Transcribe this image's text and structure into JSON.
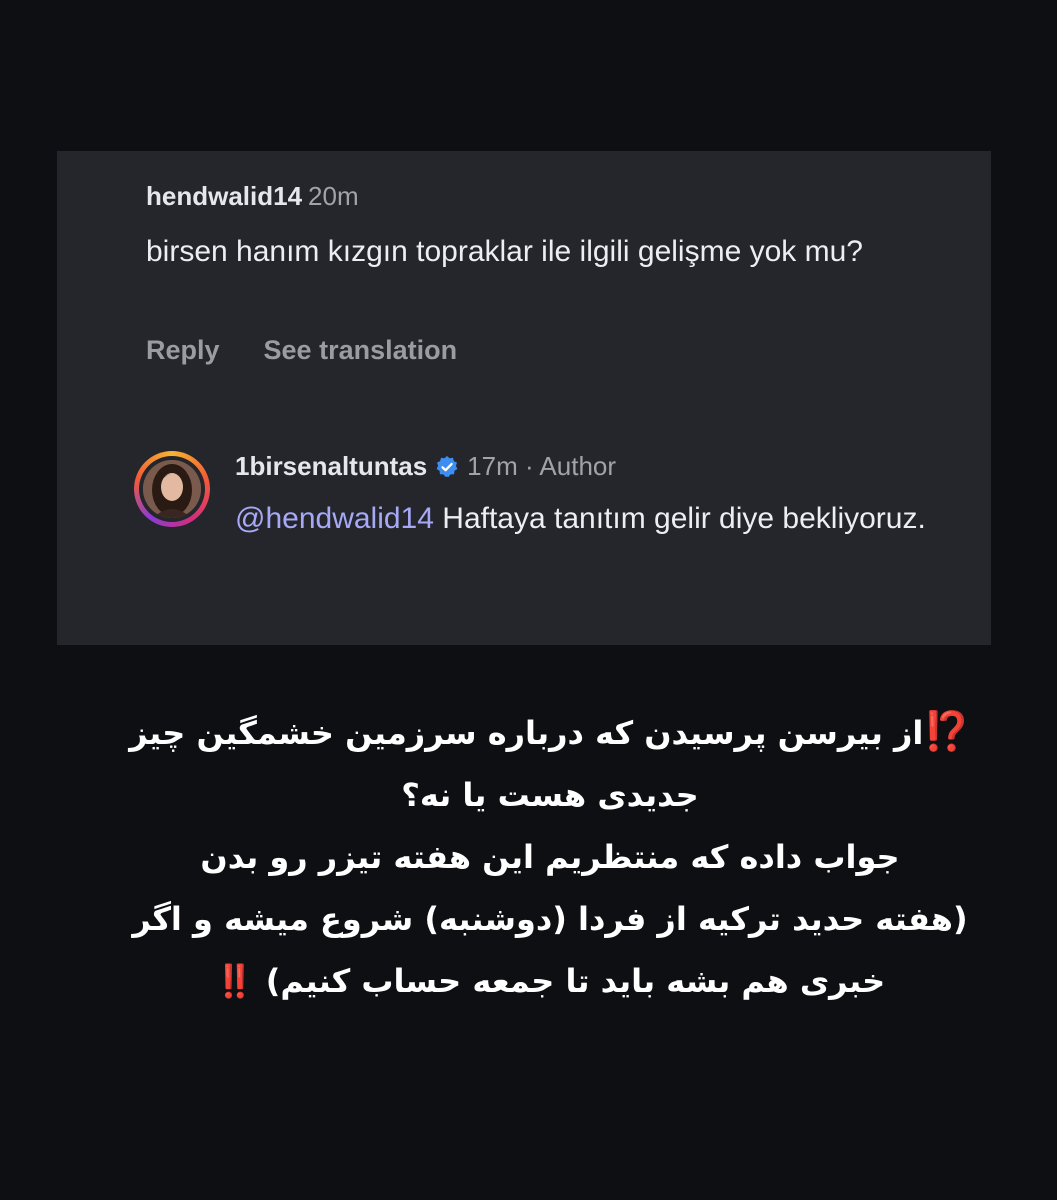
{
  "comment": {
    "username": "hendwalid14",
    "time": "20m",
    "text": "birsen hanım kızgın topraklar ile ilgili gelişme yok mu?",
    "reply_label": "Reply",
    "translate_label": "See translation"
  },
  "reply": {
    "username": "1birsenaltuntas",
    "meta": "17m · Author",
    "mention": "@hendwalid14",
    "text": " Haftaya tanıtım gelir diye bekliyoruz."
  },
  "caption": {
    "line1": "از بیرسن پرسیدن که درباره سرزمین خشمگین چیز",
    "emoji1": "⁉️",
    "line2": "جدیدی هست یا نه؟",
    "line3": "جواب داده که منتظریم این هفته تیزر رو بدن",
    "line4": "(هفته حدید ترکیه از فردا (دوشنبه) شروع میشه و اگر",
    "line5": "خبری هم بشه باید تا جمعه حساب کنیم)",
    "emoji5": "‼️"
  },
  "colors": {
    "background": "#0e0f13",
    "card": "#24262b",
    "verified": "#3d8ef0",
    "mention": "#a7a9f7",
    "emoji": "#e8262d"
  }
}
